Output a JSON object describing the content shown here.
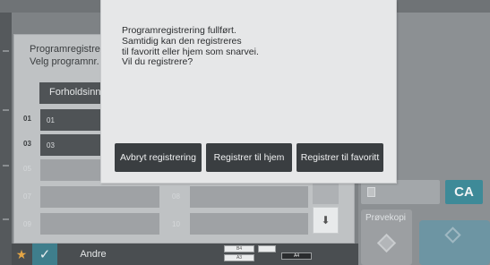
{
  "dialog": {
    "message_lines": [
      "Programregistrering fullført.",
      "Samtidig kan den registreres",
      "til favoritt eller hjem som snarvei.",
      "Vil du registrere?"
    ],
    "buttons": {
      "cancel": "Avbryt registrering",
      "home": "Registrer til hjem",
      "favorite": "Registrer til favoritt"
    }
  },
  "program_panel": {
    "title": "Programregistreri",
    "subtitle": "Velg programnr. f",
    "ratio_button": "Forholdsinns",
    "rows": [
      {
        "num": "01",
        "label": "01"
      },
      {
        "num": "03",
        "label": "03"
      },
      {
        "num": "05",
        "label": ""
      },
      {
        "num": "07",
        "label": ""
      },
      {
        "num": "08",
        "label": ""
      },
      {
        "num": "09",
        "label": ""
      },
      {
        "num": "10",
        "label": ""
      }
    ]
  },
  "right_panel": {
    "ca_label": "CA",
    "preview_label": "Prøvekopi"
  },
  "bottom_bar": {
    "star_icon": "star-icon",
    "check_icon": "check-icon",
    "other_label": "Andre",
    "thumb_labels": [
      "B4",
      "A4",
      "A3",
      "A4"
    ]
  },
  "colors": {
    "dialog_bg": "#e6e7e8",
    "button_dark": "#3a3e41",
    "accent_teal": "#3e8a98",
    "star": "#e4a545"
  }
}
